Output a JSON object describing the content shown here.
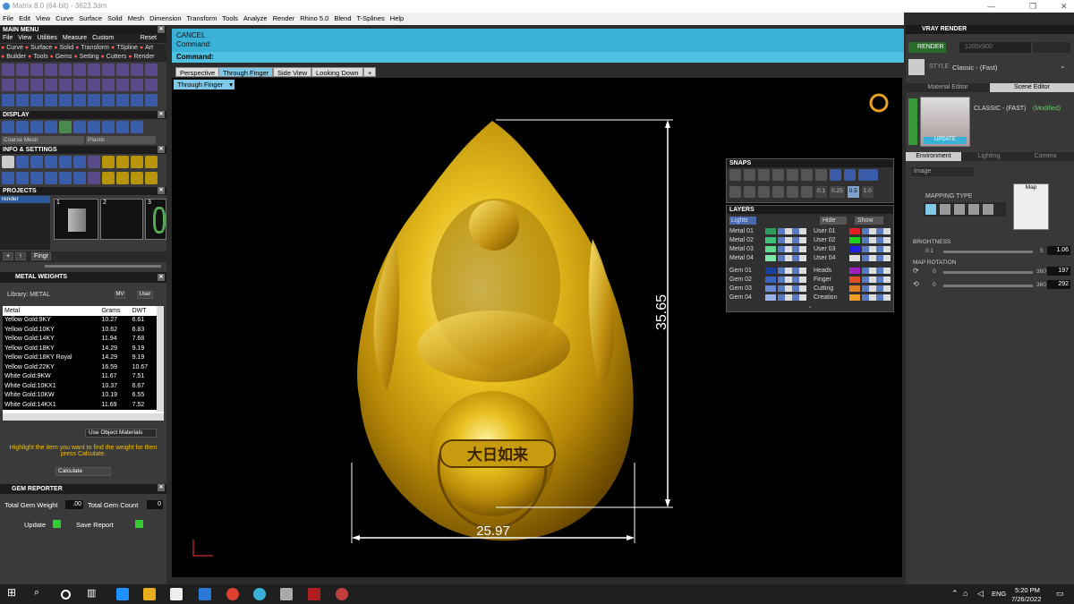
{
  "title": "Matrix 8.0 (64-bit) - 3623.3dm",
  "menubar": [
    "File",
    "Edit",
    "View",
    "Curve",
    "Surface",
    "Solid",
    "Mesh",
    "Dimension",
    "Transform",
    "Tools",
    "Analyze",
    "Render",
    "Rhino 5.0",
    "Blend",
    "T-Splines",
    "Help"
  ],
  "command": {
    "cancel": "CANCEL",
    "prompt1": "Command:",
    "prompt2": "Command:"
  },
  "viewtabs": [
    "Perspective",
    "Through Finger",
    "Side View",
    "Looking Down",
    "+"
  ],
  "active_view_label": "Through Finger",
  "main_menu": {
    "title": "MAIN MENU",
    "menu": [
      "File",
      "View",
      "Utilities",
      "Measure",
      "Custom"
    ],
    "reset": "Reset",
    "row1": [
      "Curve",
      "Surface",
      "Solid",
      "Transform",
      "TSpline",
      "Art"
    ],
    "row2": [
      "Builder",
      "Tools",
      "Gems",
      "Setting",
      "Cutters",
      "Render"
    ]
  },
  "display": {
    "title": "DISPLAY",
    "mesh": "Coarse Mesh",
    "material": "Plastic"
  },
  "info_settings": {
    "title": "INFO & SETTINGS"
  },
  "projects": {
    "title": "PROJECTS",
    "item": "render",
    "thumbs": [
      "1",
      "2",
      "3"
    ]
  },
  "metal_weights": {
    "title": "METAL WEIGHTS",
    "library_label": "Library: METAL",
    "mv": "MV",
    "user": "User",
    "columns": [
      "Metal",
      "Grams",
      "DWT"
    ],
    "rows": [
      [
        "Yellow Gold:9KY",
        "10.27",
        "6.61"
      ],
      [
        "Yellow Gold:10KY",
        "10.62",
        "6.83"
      ],
      [
        "Yellow Gold:14KY",
        "11.94",
        "7.68"
      ],
      [
        "Yellow Gold:18KY",
        "14.29",
        "9.19"
      ],
      [
        "Yellow Gold:18KY Royal",
        "14.29",
        "9.19"
      ],
      [
        "Yellow Gold:22KY",
        "16.59",
        "10.67"
      ],
      [
        "White Gold:9KW",
        "11.67",
        "7.51"
      ],
      [
        "White Gold:10KX1",
        "10.37",
        "6.67"
      ],
      [
        "White Gold:10KW",
        "10.19",
        "6.55"
      ],
      [
        "White Gold:14KX1",
        "11.69",
        "7.52"
      ]
    ],
    "use_object_materials": "Use Object Materials",
    "hint": "Highlight the item you want to find the weight for then press Calculate.",
    "calculate": "Calculate"
  },
  "gem_reporter": {
    "title": "GEM REPORTER",
    "total_weight_label": "Total Gem Weight",
    "total_weight": ".00",
    "total_count_label": "Total Gem Count",
    "total_count": "0",
    "update": "Update",
    "save_report": "Save Report"
  },
  "dimensions": {
    "height": "35.65",
    "width": "25.97"
  },
  "stamp_text": "大日如来",
  "snaps": {
    "title": "SNAPS",
    "values": [
      "0.1",
      "0.25",
      "0.5",
      "1.0"
    ]
  },
  "layers": {
    "title": "LAYERS",
    "lights": "Lights",
    "hide": "Hide",
    "show": "Show",
    "left": [
      {
        "name": "Metal 01",
        "color": "#2e9a5e"
      },
      {
        "name": "Metal 02",
        "color": "#3cc07a"
      },
      {
        "name": "Metal 03",
        "color": "#5ed88e"
      },
      {
        "name": "Metal 04",
        "color": "#7de6a8"
      },
      {
        "name": "Gem 01",
        "color": "#1a3fa0"
      },
      {
        "name": "Gem 02",
        "color": "#3a62c0"
      },
      {
        "name": "Gem 03",
        "color": "#6a8ad8"
      },
      {
        "name": "Gem 04",
        "color": "#9ab0e8"
      }
    ],
    "right": [
      {
        "name": "User 01",
        "color": "#e02020"
      },
      {
        "name": "User 02",
        "color": "#20d020"
      },
      {
        "name": "User 03",
        "color": "#2020e0"
      },
      {
        "name": "User 04",
        "color": "#e0e0e0"
      },
      {
        "name": "Heads",
        "color": "#a020c0"
      },
      {
        "name": "Finger",
        "color": "#e05020"
      },
      {
        "name": "Cutting",
        "color": "#e08020"
      },
      {
        "name": "Creation",
        "color": "#f0a020"
      }
    ]
  },
  "vray": {
    "title": "VRAY RENDER",
    "render": "RENDER",
    "resolution": "1200x900",
    "style_label": "STYLE",
    "style": "Classic - (Fast)",
    "tabs": [
      "Material Editor",
      "Scene Editor"
    ],
    "preset": "CLASSIC - (FAST)",
    "modified": "(Modified)",
    "update": "UPDATE",
    "env_tabs": [
      "Environment",
      "Lighting",
      "Camera"
    ],
    "image_option": "Image",
    "mapping_type": "MAPPING TYPE",
    "map": "Map",
    "brightness_label": "BRIGHTNESS",
    "brightness_min": "0.1",
    "brightness_max": "5",
    "brightness": "1.06",
    "rotation_label": "MAP ROTATION",
    "rot1_min": "0",
    "rot1_max": "360",
    "rot1": "197",
    "rot2_min": "0",
    "rot2_max": "360",
    "rot2": "292"
  },
  "taskbar": {
    "lang": "ENG",
    "time": "5:20 PM",
    "date": "7/26/2022"
  },
  "colors": {
    "accent": "#3ab2d8",
    "gold": "#d4a017",
    "highlight_text": "#f0c000"
  }
}
